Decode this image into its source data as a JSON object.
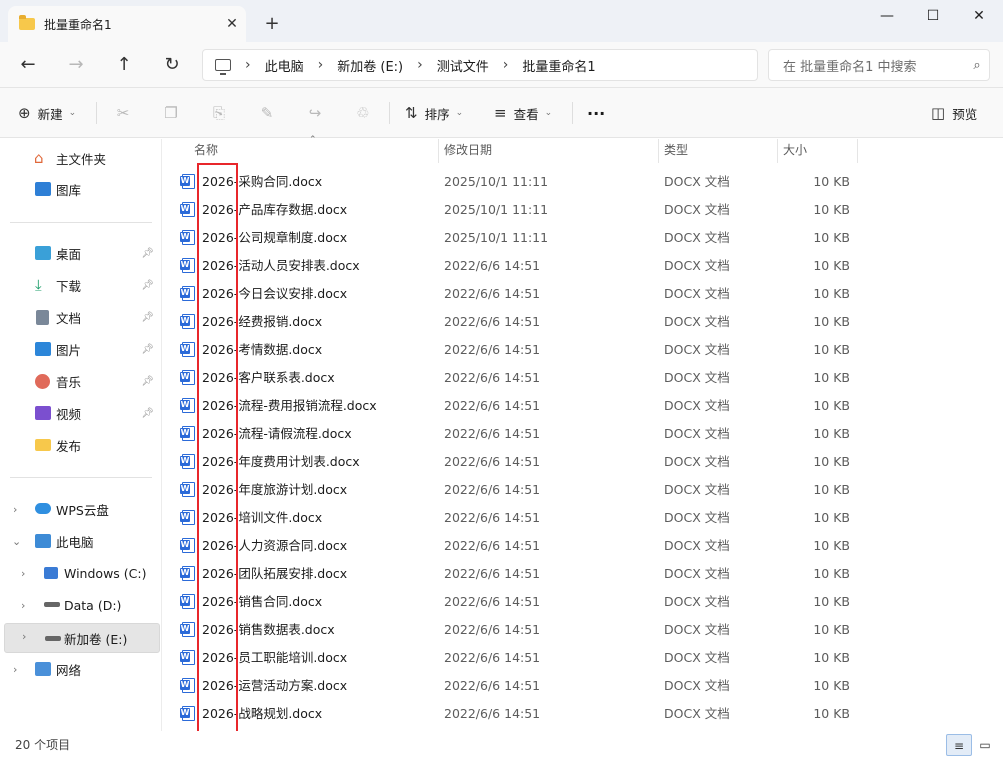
{
  "window": {
    "tab_title": "批量重命名1",
    "tab_close": "✕",
    "new_tab": "+",
    "minimize": "—",
    "maximize": "☐",
    "close": "✕"
  },
  "nav": {
    "back": "←",
    "forward": "→",
    "up": "↑",
    "refresh": "↻",
    "breadcrumb": [
      "此电脑",
      "新加卷 (E:)",
      "测试文件",
      "批量重命名1"
    ],
    "separator": "›",
    "search_placeholder": "在 批量重命名1 中搜索"
  },
  "toolbar": {
    "new_label": "新建",
    "sort_label": "排序",
    "view_label": "查看",
    "more": "···",
    "preview_label": "预览"
  },
  "sidebar": {
    "quick": [
      {
        "label": "主文件夹",
        "icon": "home-icon"
      },
      {
        "label": "图库",
        "icon": "gallery-icon"
      }
    ],
    "pinned": [
      {
        "label": "桌面",
        "icon": "desktop-icon"
      },
      {
        "label": "下载",
        "icon": "download-icon"
      },
      {
        "label": "文档",
        "icon": "documents-icon"
      },
      {
        "label": "图片",
        "icon": "pictures-icon"
      },
      {
        "label": "音乐",
        "icon": "music-icon"
      },
      {
        "label": "视频",
        "icon": "videos-icon"
      },
      {
        "label": "发布",
        "icon": "folder-icon"
      }
    ],
    "tree": [
      {
        "label": "WPS云盘",
        "icon": "cloud-icon"
      },
      {
        "label": "此电脑",
        "icon": "computer-icon"
      },
      {
        "label": "Windows (C:)",
        "icon": "windows-drive-icon"
      },
      {
        "label": "Data (D:)",
        "icon": "drive-icon"
      },
      {
        "label": "新加卷 (E:)",
        "icon": "drive-icon"
      },
      {
        "label": "网络",
        "icon": "network-icon"
      }
    ]
  },
  "columns": {
    "name": "名称",
    "date": "修改日期",
    "type": "类型",
    "size": "大小"
  },
  "files": [
    {
      "name": "2026-采购合同.docx",
      "date": "2025/10/1 11:11",
      "type": "DOCX 文档",
      "size": "10 KB"
    },
    {
      "name": "2026-产品库存数据.docx",
      "date": "2025/10/1 11:11",
      "type": "DOCX 文档",
      "size": "10 KB"
    },
    {
      "name": "2026-公司规章制度.docx",
      "date": "2025/10/1 11:11",
      "type": "DOCX 文档",
      "size": "10 KB"
    },
    {
      "name": "2026-活动人员安排表.docx",
      "date": "2022/6/6 14:51",
      "type": "DOCX 文档",
      "size": "10 KB"
    },
    {
      "name": "2026-今日会议安排.docx",
      "date": "2022/6/6 14:51",
      "type": "DOCX 文档",
      "size": "10 KB"
    },
    {
      "name": "2026-经费报销.docx",
      "date": "2022/6/6 14:51",
      "type": "DOCX 文档",
      "size": "10 KB"
    },
    {
      "name": "2026-考情数据.docx",
      "date": "2022/6/6 14:51",
      "type": "DOCX 文档",
      "size": "10 KB"
    },
    {
      "name": "2026-客户联系表.docx",
      "date": "2022/6/6 14:51",
      "type": "DOCX 文档",
      "size": "10 KB"
    },
    {
      "name": "2026-流程-费用报销流程.docx",
      "date": "2022/6/6 14:51",
      "type": "DOCX 文档",
      "size": "10 KB"
    },
    {
      "name": "2026-流程-请假流程.docx",
      "date": "2022/6/6 14:51",
      "type": "DOCX 文档",
      "size": "10 KB"
    },
    {
      "name": "2026-年度费用计划表.docx",
      "date": "2022/6/6 14:51",
      "type": "DOCX 文档",
      "size": "10 KB"
    },
    {
      "name": "2026-年度旅游计划.docx",
      "date": "2022/6/6 14:51",
      "type": "DOCX 文档",
      "size": "10 KB"
    },
    {
      "name": "2026-培训文件.docx",
      "date": "2022/6/6 14:51",
      "type": "DOCX 文档",
      "size": "10 KB"
    },
    {
      "name": "2026-人力资源合同.docx",
      "date": "2022/6/6 14:51",
      "type": "DOCX 文档",
      "size": "10 KB"
    },
    {
      "name": "2026-团队拓展安排.docx",
      "date": "2022/6/6 14:51",
      "type": "DOCX 文档",
      "size": "10 KB"
    },
    {
      "name": "2026-销售合同.docx",
      "date": "2022/6/6 14:51",
      "type": "DOCX 文档",
      "size": "10 KB"
    },
    {
      "name": "2026-销售数据表.docx",
      "date": "2022/6/6 14:51",
      "type": "DOCX 文档",
      "size": "10 KB"
    },
    {
      "name": "2026-员工职能培训.docx",
      "date": "2022/6/6 14:51",
      "type": "DOCX 文档",
      "size": "10 KB"
    },
    {
      "name": "2026-运营活动方案.docx",
      "date": "2022/6/6 14:51",
      "type": "DOCX 文档",
      "size": "10 KB"
    },
    {
      "name": "2026-战略规划.docx",
      "date": "2022/6/6 14:51",
      "type": "DOCX 文档",
      "size": "10 KB"
    }
  ],
  "status": {
    "item_count": "20 个项目"
  },
  "colors": {
    "accent": "#2b6ad8",
    "highlight": "#e8262b",
    "folder": "#f7c84b"
  }
}
